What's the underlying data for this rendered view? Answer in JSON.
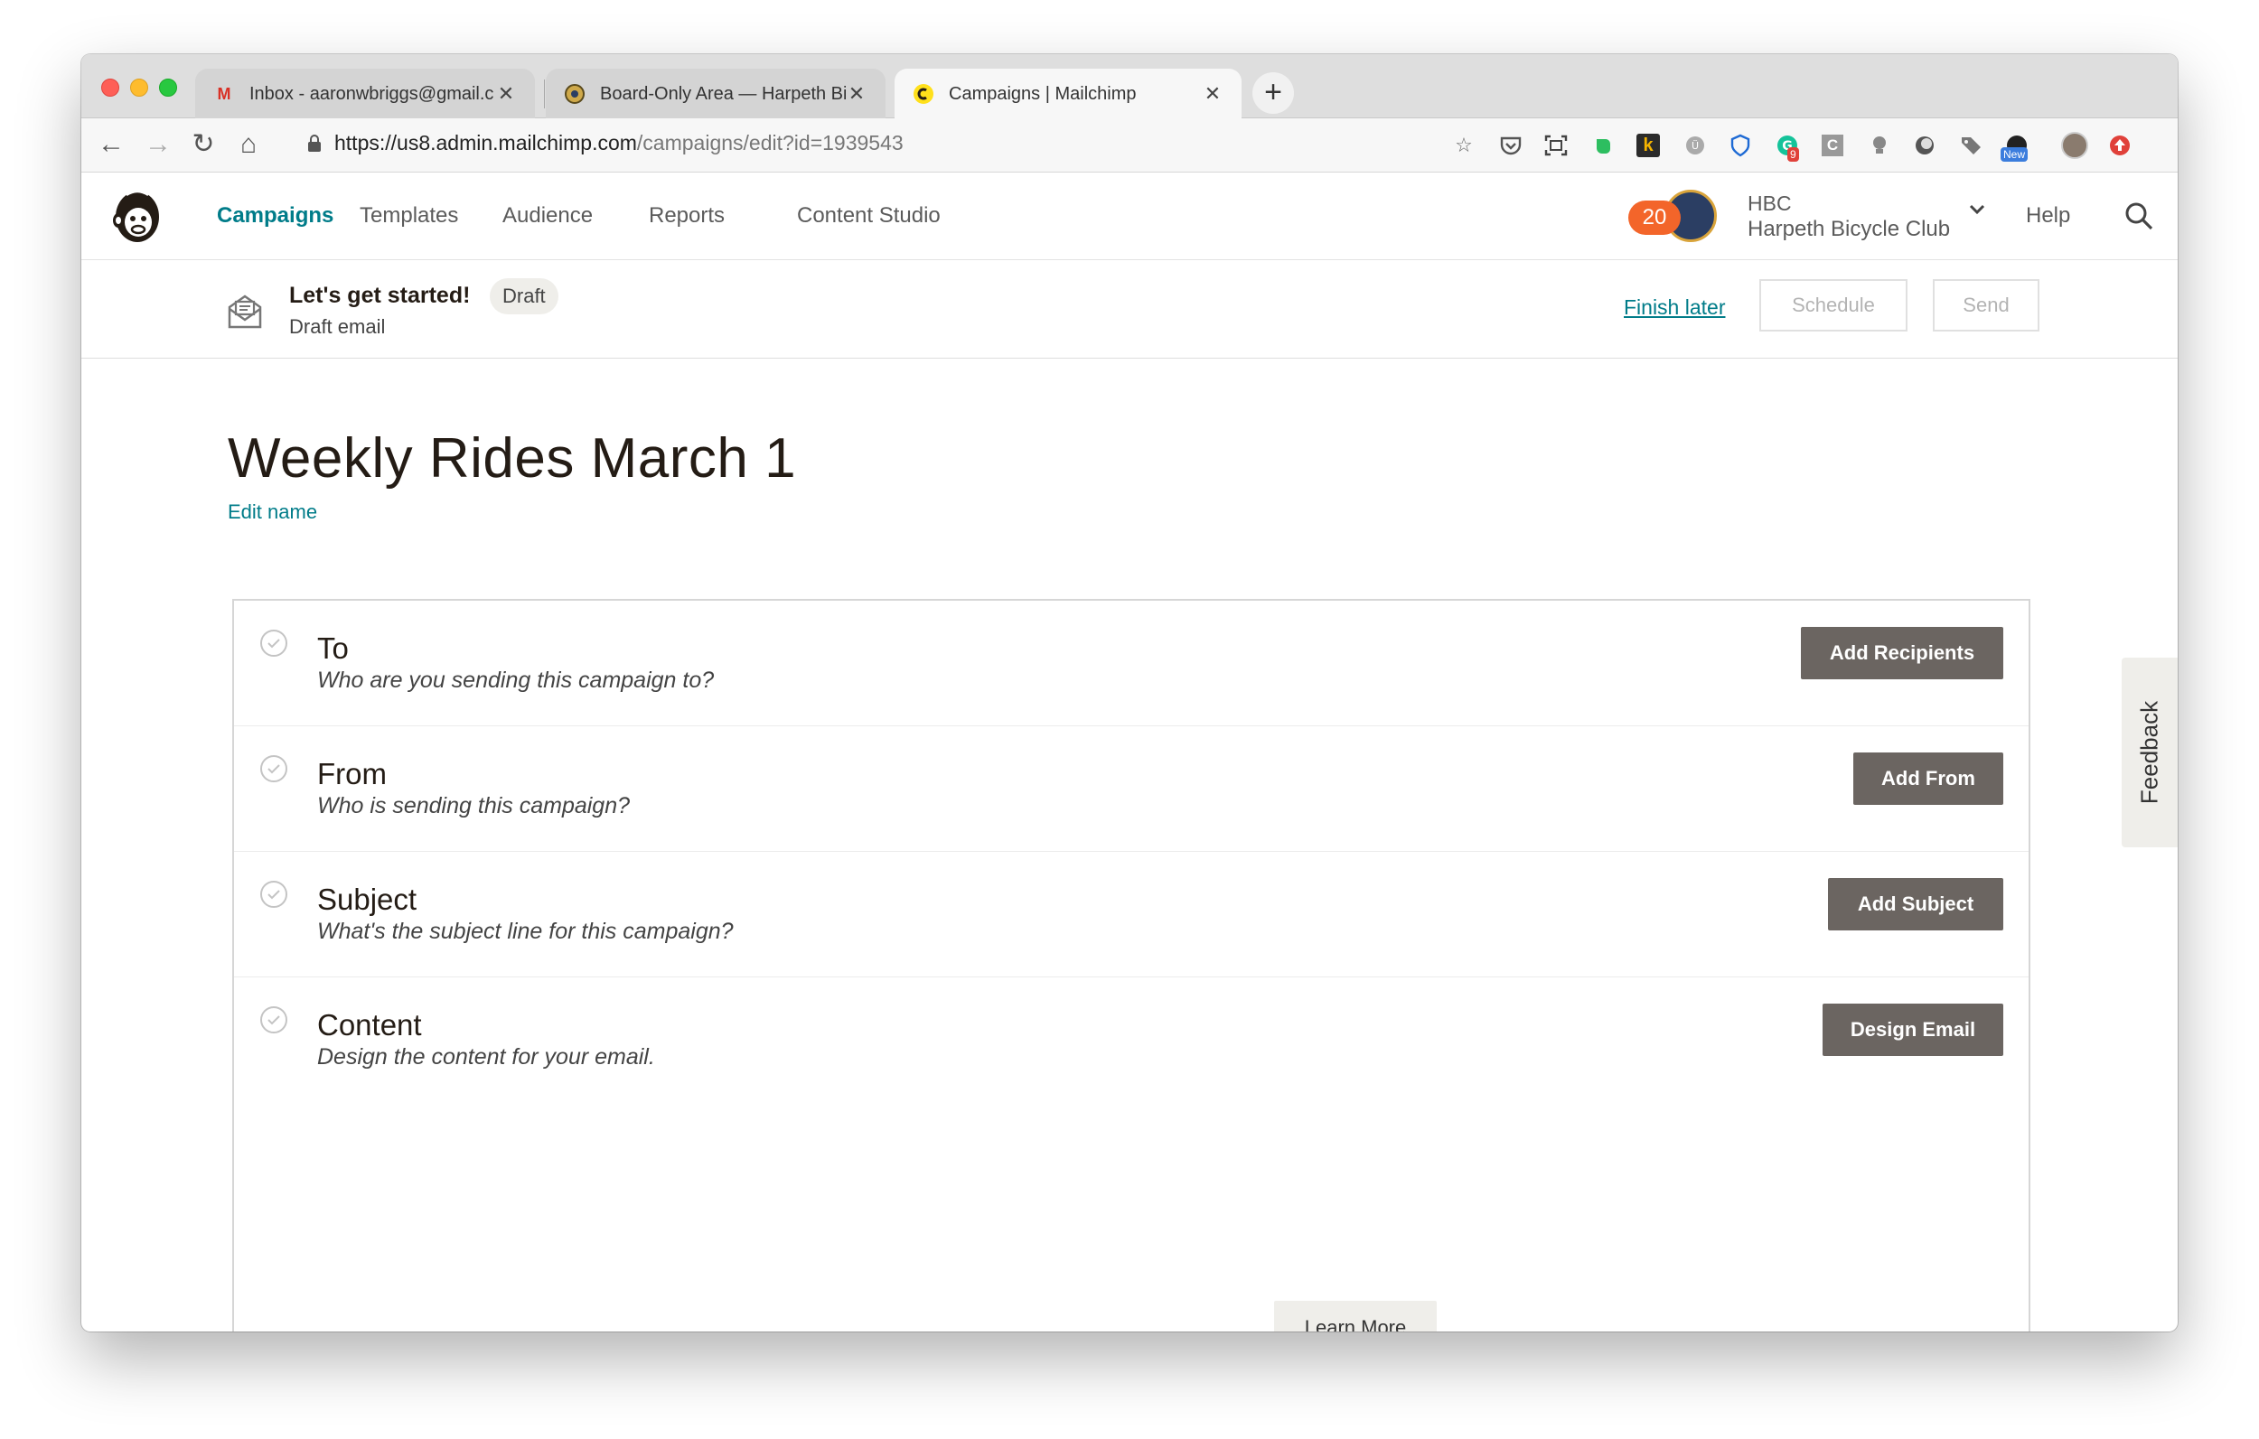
{
  "browser": {
    "tabs": [
      {
        "title": "Inbox - aaronwbriggs@gmail.c",
        "favicon": "gmail-icon",
        "active": false
      },
      {
        "title": "Board-Only Area — Harpeth Bi",
        "favicon": "bike-club-icon",
        "active": false
      },
      {
        "title": "Campaigns | Mailchimp",
        "favicon": "mailchimp-icon",
        "active": true
      }
    ],
    "url_host": "https://us8.admin.mailchimp.com",
    "url_path": "/campaigns/edit?id=1939543",
    "ext_badge_count": "9",
    "ext_new_label": "New"
  },
  "header": {
    "nav": [
      "Campaigns",
      "Templates",
      "Audience",
      "Reports",
      "Content Studio"
    ],
    "active_nav": "Campaigns",
    "notifications": "20",
    "account_short": "HBC",
    "account_name": "Harpeth Bicycle Club",
    "help": "Help"
  },
  "draft_bar": {
    "title": "Let's get started!",
    "badge": "Draft",
    "subtitle": "Draft email",
    "finish_later": "Finish later",
    "schedule": "Schedule",
    "send": "Send"
  },
  "campaign": {
    "name": "Weekly Rides March 1",
    "edit_name": "Edit name"
  },
  "checklist": [
    {
      "title": "To",
      "description": "Who are you sending this campaign to?",
      "button": "Add Recipients"
    },
    {
      "title": "From",
      "description": "Who is sending this campaign?",
      "button": "Add From"
    },
    {
      "title": "Subject",
      "description": "What's the subject line for this campaign?",
      "button": "Add Subject"
    },
    {
      "title": "Content",
      "description": "Design the content for your email.",
      "button": "Design Email"
    }
  ],
  "learn_more": "Learn More",
  "feedback": "Feedback",
  "colors": {
    "accent": "#007c89",
    "button_dark": "#6b6561",
    "notification": "#f3652a"
  }
}
